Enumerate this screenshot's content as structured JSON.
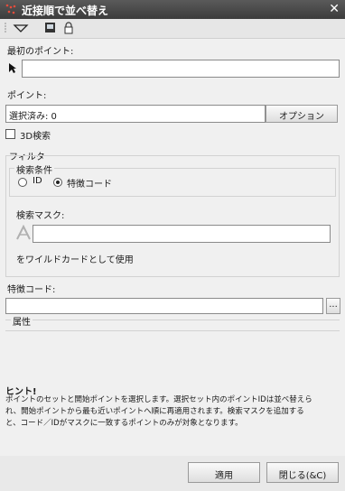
{
  "window": {
    "title": "近接順で並べ替え",
    "close_glyph": "✕"
  },
  "toolbar": {
    "icons": [
      "dropdown-arrow-icon",
      "save-image-icon",
      "lock-icon"
    ]
  },
  "first_point": {
    "label": "最初のポイント:",
    "value": ""
  },
  "points": {
    "label": "ポイント:",
    "value": "選択済み: 0",
    "options_button": "オプション"
  },
  "search_3d": {
    "label": "3D検索",
    "checked": false
  },
  "filter": {
    "label": "フィルタ",
    "conditions": {
      "label": "検索条件",
      "options": [
        {
          "label": "ID",
          "selected": false
        },
        {
          "label": "特徴コード",
          "selected": true
        }
      ]
    },
    "mask": {
      "label": "検索マスク:",
      "value": "",
      "wildcard_text": "をワイルドカードとして使用"
    }
  },
  "feature_code": {
    "label": "特徴コード:",
    "value": "",
    "browse_button": "..."
  },
  "attributes": {
    "label": "属性"
  },
  "hint": {
    "title": "ヒント!",
    "lines": [
      "ポイントのセットと開始ポイントを選択します。選択セット内のポイントIDは並べ替えら",
      "れ、開始ポイントから最も近いポイントへ順に再適用されます。検索マスクを追加する",
      "と、コード／IDがマスクに一致するポイントのみが対象となります。"
    ]
  },
  "buttons": {
    "apply": "適用",
    "close": "閉じる(&C)"
  },
  "colors": {
    "titlebar": "#474747",
    "accent_red": "#c0392b"
  }
}
